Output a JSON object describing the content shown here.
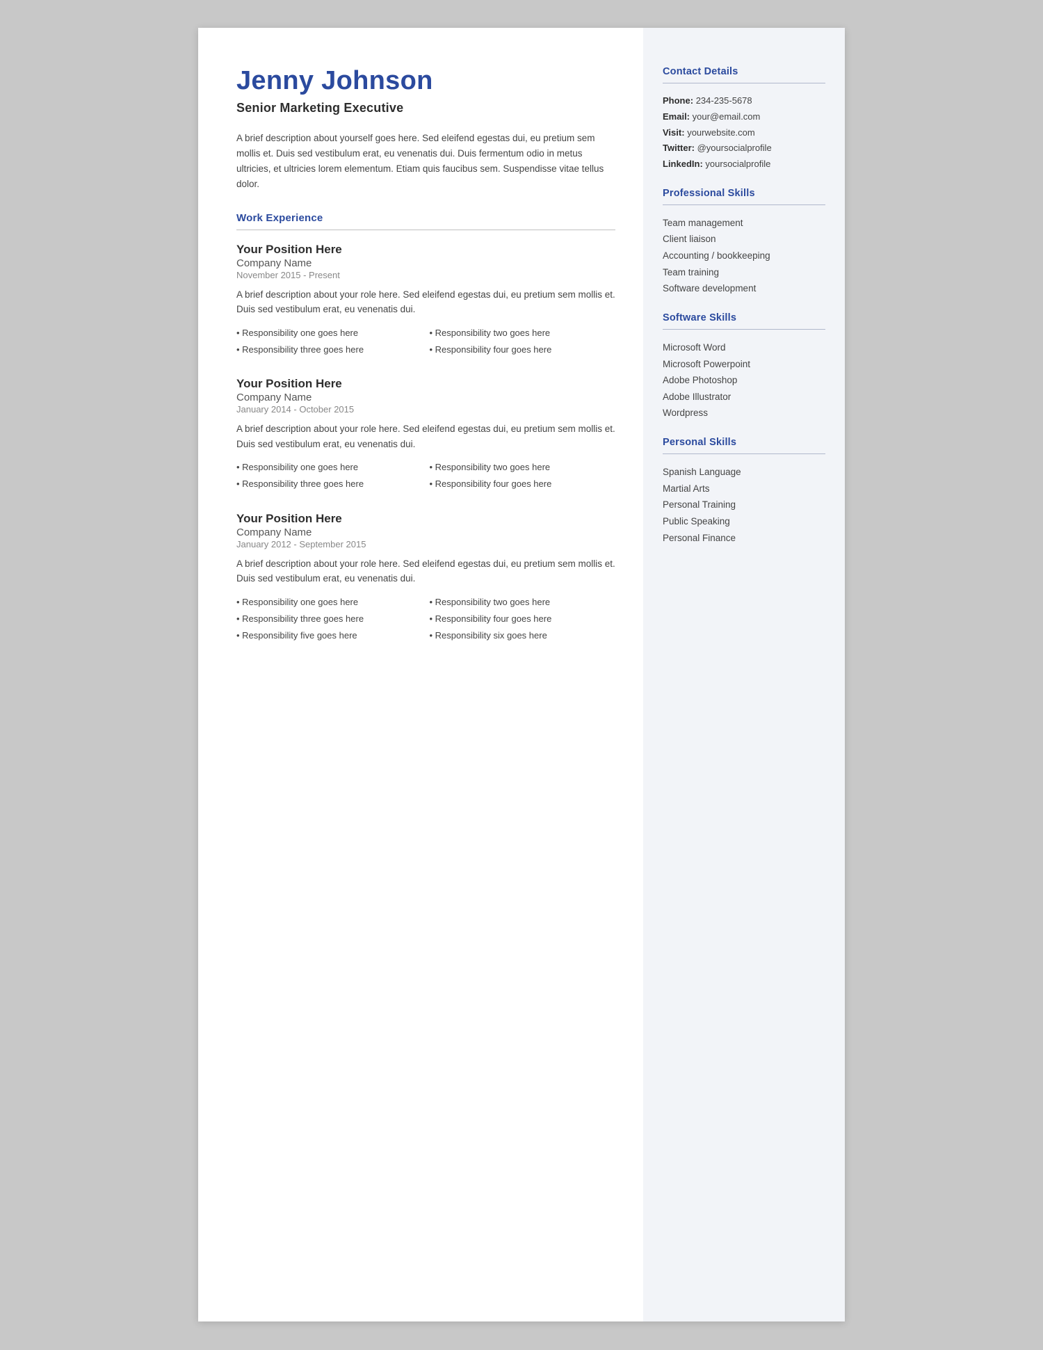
{
  "header": {
    "name": "Jenny Johnson",
    "title": "Senior Marketing Executive",
    "bio": "A brief description about yourself goes here. Sed eleifend egestas dui, eu pretium sem mollis et. Duis sed vestibulum erat, eu venenatis dui. Duis fermentum odio in metus ultricies, et ultricies lorem elementum. Etiam quis faucibus sem. Suspendisse vitae tellus dolor."
  },
  "sections": {
    "work_experience_title": "Work Experience"
  },
  "jobs": [
    {
      "title": "Your Position Here",
      "company": "Company Name",
      "dates": "November 2015 - Present",
      "desc": "A brief description about your role here. Sed eleifend egestas dui, eu pretium sem mollis et. Duis sed vestibulum erat, eu venenatis dui.",
      "responsibilities": [
        "Responsibility one goes here",
        "Responsibility two goes here",
        "Responsibility three goes here",
        "Responsibility four goes here"
      ]
    },
    {
      "title": "Your Position Here",
      "company": "Company Name",
      "dates": "January 2014 - October 2015",
      "desc": "A brief description about your role here. Sed eleifend egestas dui, eu pretium sem mollis et. Duis sed vestibulum erat, eu venenatis dui.",
      "responsibilities": [
        "Responsibility one goes here",
        "Responsibility two goes here",
        "Responsibility three goes here",
        "Responsibility four goes here"
      ]
    },
    {
      "title": "Your Position Here",
      "company": "Company Name",
      "dates": "January 2012 - September 2015",
      "desc": "A brief description about your role here. Sed eleifend egestas dui, eu pretium sem mollis et. Duis sed vestibulum erat, eu venenatis dui.",
      "responsibilities": [
        "Responsibility one goes here",
        "Responsibility two goes here",
        "Responsibility three goes here",
        "Responsibility four goes here",
        "Responsibility five goes here",
        "Responsibility six goes here"
      ]
    }
  ],
  "sidebar": {
    "contact_title": "Contact Details",
    "contact": {
      "phone_label": "Phone:",
      "phone": "234-235-5678",
      "email_label": "Email:",
      "email": "your@email.com",
      "visit_label": "Visit:",
      "visit": " yourwebsite.com",
      "twitter_label": "Twitter:",
      "twitter": "@yoursocialprofile",
      "linkedin_label": "LinkedIn:",
      "linkedin": "yoursocialprofile"
    },
    "professional_skills_title": "Professional Skills",
    "professional_skills": [
      "Team management",
      "Client liaison",
      "Accounting / bookkeeping",
      "Team training",
      "Software development"
    ],
    "software_skills_title": "Software Skills",
    "software_skills": [
      "Microsoft Word",
      "Microsoft Powerpoint",
      "Adobe Photoshop",
      "Adobe Illustrator",
      "Wordpress"
    ],
    "personal_skills_title": "Personal Skills",
    "personal_skills": [
      "Spanish Language",
      "Martial Arts",
      "Personal Training",
      "Public Speaking",
      "Personal Finance"
    ]
  }
}
